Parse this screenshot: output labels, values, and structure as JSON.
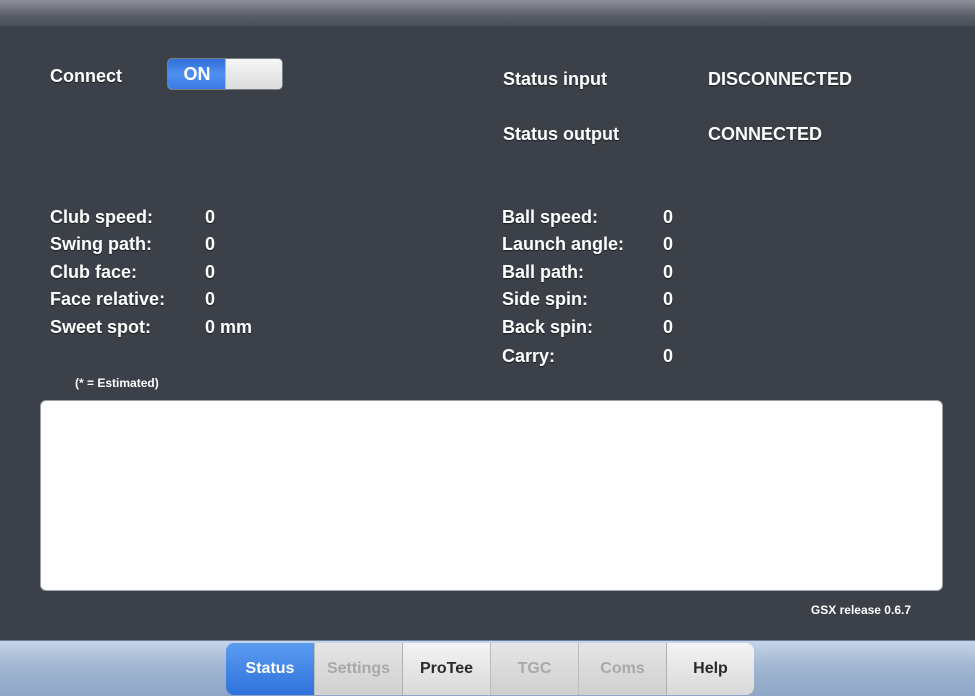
{
  "connect": {
    "label": "Connect",
    "toggle_label": "ON",
    "toggle_state": true
  },
  "status": {
    "input_label": "Status input",
    "input_value": "DISCONNECTED",
    "output_label": "Status output",
    "output_value": "CONNECTED"
  },
  "club_metrics": [
    {
      "label": "Club speed:",
      "value": "0"
    },
    {
      "label": "Swing path:",
      "value": "0"
    },
    {
      "label": "Club face:",
      "value": "0"
    },
    {
      "label": "Face relative:",
      "value": "0"
    },
    {
      "label": "Sweet spot:",
      "value": "0 mm"
    }
  ],
  "ball_metrics": [
    {
      "label": "Ball speed:",
      "value": "0"
    },
    {
      "label": "Launch angle:",
      "value": "0"
    },
    {
      "label": "Ball path:",
      "value": "0"
    },
    {
      "label": "Side spin:",
      "value": "0"
    },
    {
      "label": "Back spin:",
      "value": "0"
    },
    {
      "label": "Carry:",
      "value": "0"
    }
  ],
  "note": "(* = Estimated)",
  "log": {
    "content": ""
  },
  "release": "GSX release 0.6.7",
  "tabs": [
    {
      "label": "Status",
      "state": "active"
    },
    {
      "label": "Settings",
      "state": "disabled"
    },
    {
      "label": "ProTee",
      "state": "enabled"
    },
    {
      "label": "TGC",
      "state": "disabled"
    },
    {
      "label": "Coms",
      "state": "disabled"
    },
    {
      "label": "Help",
      "state": "enabled"
    }
  ],
  "colors": {
    "background": "#3c4048",
    "accent": "#3a7be6",
    "text": "#ffffff"
  }
}
